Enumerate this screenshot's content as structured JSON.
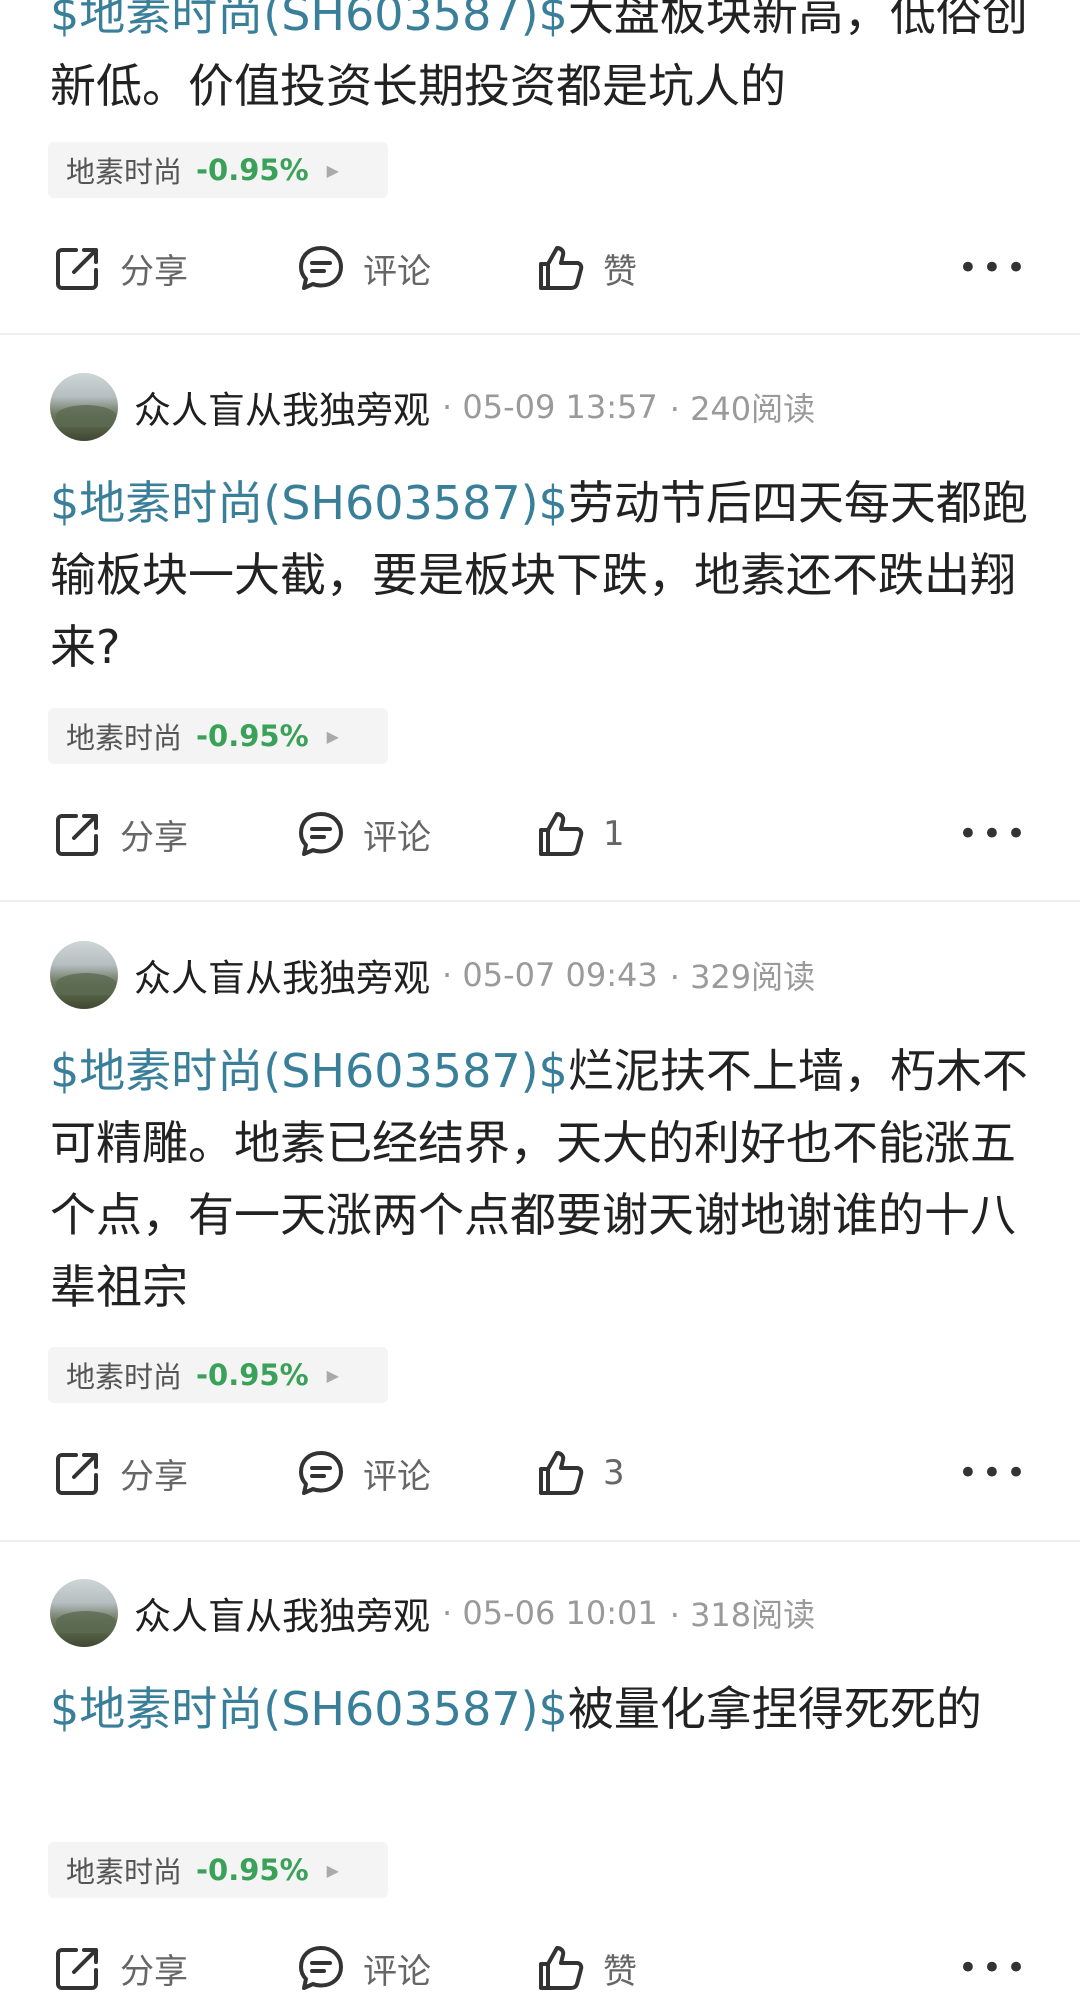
{
  "posts": [
    {
      "author": "",
      "date": "",
      "reads": "",
      "tag": "$地素时尚(SH603587)$",
      "text": "大盘板块新高，低俗创新低。价值投资长期投资都是坑人的",
      "stock_name": "地素时尚",
      "stock_change": "-0.95%",
      "share_label": "分享",
      "comment_label": "评论",
      "like_label": "赞"
    },
    {
      "author": "众人盲从我独旁观",
      "date": "· 05-09 13:57",
      "reads": "· 240阅读",
      "tag": "$地素时尚(SH603587)$",
      "text": "劳动节后四天每天都跑输板块一大截，要是板块下跌，地素还不跌出翔来?",
      "stock_name": "地素时尚",
      "stock_change": "-0.95%",
      "share_label": "分享",
      "comment_label": "评论",
      "like_label": "1"
    },
    {
      "author": "众人盲从我独旁观",
      "date": "· 05-07 09:43",
      "reads": "· 329阅读",
      "tag": "$地素时尚(SH603587)$",
      "text": "烂泥扶不上墙，朽木不可精雕。地素已经结界，天大的利好也不能涨五个点，有一天涨两个点都要谢天谢地谢谁的十八辈祖宗",
      "stock_name": "地素时尚",
      "stock_change": "-0.95%",
      "share_label": "分享",
      "comment_label": "评论",
      "like_label": "3"
    },
    {
      "author": "众人盲从我独旁观",
      "date": "· 05-06 10:01",
      "reads": "· 318阅读",
      "tag": "$地素时尚(SH603587)$",
      "text": "被量化拿捏得死死的",
      "stock_name": "地素时尚",
      "stock_change": "-0.95%",
      "share_label": "分享",
      "comment_label": "评论",
      "like_label": "赞"
    }
  ],
  "more_label": "•••",
  "chip_arrow": "▶",
  "colors": {
    "tag": "#3a7f9a",
    "change_down": "#3aa159"
  }
}
